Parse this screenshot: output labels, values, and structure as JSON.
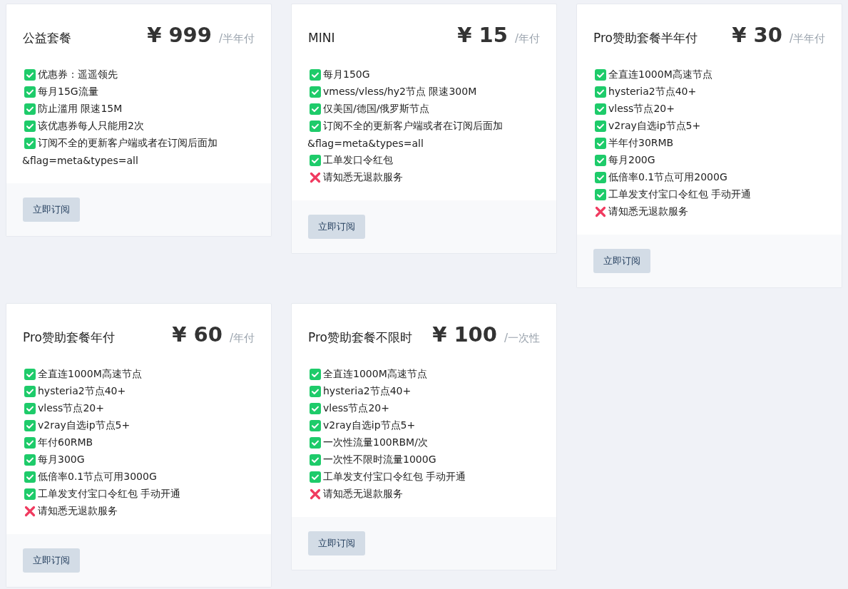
{
  "plans": [
    {
      "name": "公益套餐",
      "price": "¥ 999",
      "period": "/半年付",
      "features": [
        {
          "kind": "check",
          "text": "优惠券：遥遥领先"
        },
        {
          "kind": "check",
          "text": "每月15G流量"
        },
        {
          "kind": "check",
          "text": "防止滥用 限速15M"
        },
        {
          "kind": "check",
          "text": "该优惠券每人只能用2次"
        },
        {
          "kind": "check",
          "text": "订阅不全的更新客户端或者在订阅后面加"
        },
        {
          "kind": "plain",
          "text": "&flag=meta&types=all"
        }
      ],
      "button": "立即订阅"
    },
    {
      "name": "MINI",
      "price": "¥ 15",
      "period": "/年付",
      "features": [
        {
          "kind": "check",
          "text": "每月150G"
        },
        {
          "kind": "check",
          "text": "vmess/vless/hy2节点 限速300M"
        },
        {
          "kind": "check",
          "text": "仅美国/德国/俄罗斯节点"
        },
        {
          "kind": "check",
          "text": "订阅不全的更新客户端或者在订阅后面加"
        },
        {
          "kind": "plain",
          "text": "&flag=meta&types=all"
        },
        {
          "kind": "check",
          "text": "工单发口令红包"
        },
        {
          "kind": "cross",
          "text": "请知悉无退款服务"
        }
      ],
      "button": "立即订阅"
    },
    {
      "name": "Pro赞助套餐半年付",
      "price": "¥ 30",
      "period": "/半年付",
      "features": [
        {
          "kind": "check",
          "text": "全直连1000M高速节点"
        },
        {
          "kind": "check",
          "text": "hysteria2节点40+"
        },
        {
          "kind": "check",
          "text": "vless节点20+"
        },
        {
          "kind": "check",
          "text": "v2ray自选ip节点5+"
        },
        {
          "kind": "check",
          "text": "半年付30RMB"
        },
        {
          "kind": "check",
          "text": "每月200G"
        },
        {
          "kind": "check",
          "text": "低倍率0.1节点可用2000G"
        },
        {
          "kind": "check",
          "text": "工单发支付宝口令红包 手动开通"
        },
        {
          "kind": "cross",
          "text": "请知悉无退款服务"
        }
      ],
      "button": "立即订阅"
    },
    {
      "name": "Pro赞助套餐年付",
      "price": "¥ 60",
      "period": "/年付",
      "features": [
        {
          "kind": "check",
          "text": "全直连1000M高速节点"
        },
        {
          "kind": "check",
          "text": "hysteria2节点40+"
        },
        {
          "kind": "check",
          "text": "vless节点20+"
        },
        {
          "kind": "check",
          "text": "v2ray自选ip节点5+"
        },
        {
          "kind": "check",
          "text": "年付60RMB"
        },
        {
          "kind": "check",
          "text": "每月300G"
        },
        {
          "kind": "check",
          "text": "低倍率0.1节点可用3000G"
        },
        {
          "kind": "check",
          "text": "工单发支付宝口令红包 手动开通"
        },
        {
          "kind": "cross",
          "text": "请知悉无退款服务"
        }
      ],
      "button": "立即订阅"
    },
    {
      "name": "Pro赞助套餐不限时",
      "price": "¥ 100",
      "period": "/一次性",
      "features": [
        {
          "kind": "check",
          "text": "全直连1000M高速节点"
        },
        {
          "kind": "check",
          "text": "hysteria2节点40+"
        },
        {
          "kind": "check",
          "text": "vless节点20+"
        },
        {
          "kind": "check",
          "text": "v2ray自选ip节点5+"
        },
        {
          "kind": "check",
          "text": "一次性流量100RBM/次"
        },
        {
          "kind": "check",
          "text": "一次性不限时流量1000G"
        },
        {
          "kind": "check",
          "text": "工单发支付宝口令红包 手动开通"
        },
        {
          "kind": "cross",
          "text": "请知悉无退款服务"
        }
      ],
      "button": "立即订阅"
    }
  ]
}
